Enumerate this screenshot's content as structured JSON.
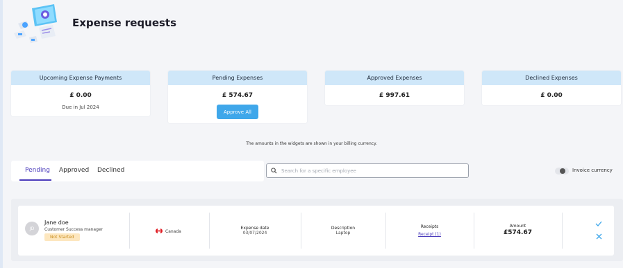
{
  "page": {
    "title": "Expense requests"
  },
  "widgets": [
    {
      "title": "Upcoming Expense Payments",
      "amount": "£ 0.00",
      "sub": "Due in Jul 2024"
    },
    {
      "title": "Pending Expenses",
      "amount": "£ 574.67",
      "button": "Approve All"
    },
    {
      "title": "Approved Expenses",
      "amount": "£ 997.61"
    },
    {
      "title": "Declined Expenses",
      "amount": "£ 0.00"
    }
  ],
  "billing_note": "The amounts in the widgets are shown in your billing currency.",
  "tabs": [
    {
      "label": "Pending"
    },
    {
      "label": "Approved"
    },
    {
      "label": "Declined"
    }
  ],
  "active_tab": "Pending",
  "search": {
    "placeholder": "Search for a specific employee",
    "value": ""
  },
  "invoice_toggle": {
    "label": "Invoice currency",
    "on": false
  },
  "requests": [
    {
      "initials": "JD",
      "name": "Jane doe",
      "role": "Customer Success manager",
      "status": "Not Started",
      "country": "Canada",
      "date_label": "Expense date",
      "date": "03/07/2024",
      "description_label": "Description",
      "description": "Laptop",
      "receipts_label": "Receipts",
      "receipts_link": "Receipt (1)",
      "amount_label": "Amount",
      "amount": "£574.67"
    }
  ],
  "colors": {
    "accent": "#4a3bbb",
    "widget_header": "#cfe7f9",
    "button": "#3fa7ea",
    "badge_bg": "#fde7bf",
    "badge_text": "#c98f22"
  }
}
